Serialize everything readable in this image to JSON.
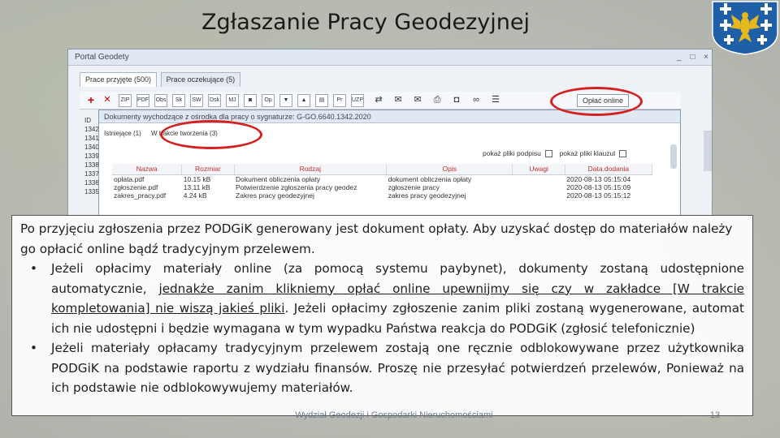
{
  "slide": {
    "title": "Zgłaszanie Pracy Geodezyjnej",
    "footer": "Wydział Geodezji i Gospodarki Nieruchomościami",
    "page_number": "13"
  },
  "window": {
    "title": "Portal Geodety",
    "controls": [
      "_",
      "□",
      "×"
    ],
    "tabs": [
      "Prace przyjęte (500)",
      "Prace oczekujące (5)"
    ],
    "toolbar_buttons": [
      "ZIP",
      "PDF",
      "Obs",
      "Sk",
      "SW",
      "Dsk",
      "MJ",
      "Op",
      "Pr",
      "UZP"
    ],
    "pay_button": "Opłać online",
    "left_ids": [
      "ID",
      "1342",
      "1341",
      "1340",
      "1339",
      "1338",
      "1337",
      "1336",
      "1335"
    ]
  },
  "dialog": {
    "title": "Dokumenty wychodzące z ośrodka dla pracy o sygnaturze: G-GO.6640.1342.2020",
    "tabs": [
      "Istniejące (1)",
      "W trakcie tworzenia (3)"
    ],
    "checkbox_signature": "pokaż pliki podpisu",
    "checkbox_clause": "pokaż pliki klauzul",
    "columns": [
      "Nazwa",
      "Rozmiar",
      "Rodzaj",
      "Opis",
      "Uwagi",
      "Data dodania"
    ],
    "rows": [
      {
        "name": "opłata.pdf",
        "size": "10.15 kB",
        "type": "Dokument obliczenia opłaty",
        "desc": "dokument obliczenia opłaty",
        "notes": "",
        "date": "2020-08-13 05:15:04"
      },
      {
        "name": "zgłoszenie.pdf",
        "size": "13.11 kB",
        "type": "Potwierdzenie zgłoszenia pracy geodez",
        "desc": "zgłoszenie pracy",
        "notes": "",
        "date": "2020-08-13 05:15:09"
      },
      {
        "name": "zakres_pracy.pdf",
        "size": "4.24 kB",
        "type": "Zakres pracy geodezyjnej",
        "desc": "zakres pracy geodezyjnej",
        "notes": "",
        "date": "2020-08-13 05:15:12"
      }
    ]
  },
  "panel": {
    "intro": "Po przyjęciu zgłoszenia przez PODGiK generowany jest dokument opłaty. Aby uzyskać dostęp do materiałów należy go opłacić online bądź tradycyjnym przelewem.",
    "bullet_mark": "•",
    "b1_part1": "Jeżeli opłacimy materiały online (za pomocą systemu paybynet), dokumenty zostaną udostępnione automatycznie, ",
    "b1_underlined": "jednakże zanim klikniemy opłać online upewnijmy się czy w zakładce [W trakcie kompletowania] nie wiszą jakieś pliki",
    "b1_part2": ". Jeżeli opłacimy zgłoszenie zanim pliki zostaną wygenerowane, automat ich nie udostępni i będzie wymagana w tym wypadku Państwa reakcja do PODGiK (zgłosić telefonicznie)",
    "b2": "Jeżeli materiały opłacamy tradycyjnym przelewem zostają one ręcznie odblokowywane przez użytkownika PODGiK na podstawie raportu z wydziału finansów. Proszę nie przesyłać potwierdzeń przelewów, Ponieważ na ich podstawie nie odblokowywujemy materiałów."
  },
  "colors": {
    "highlight": "#d52020",
    "grid_header": "#c03030"
  }
}
